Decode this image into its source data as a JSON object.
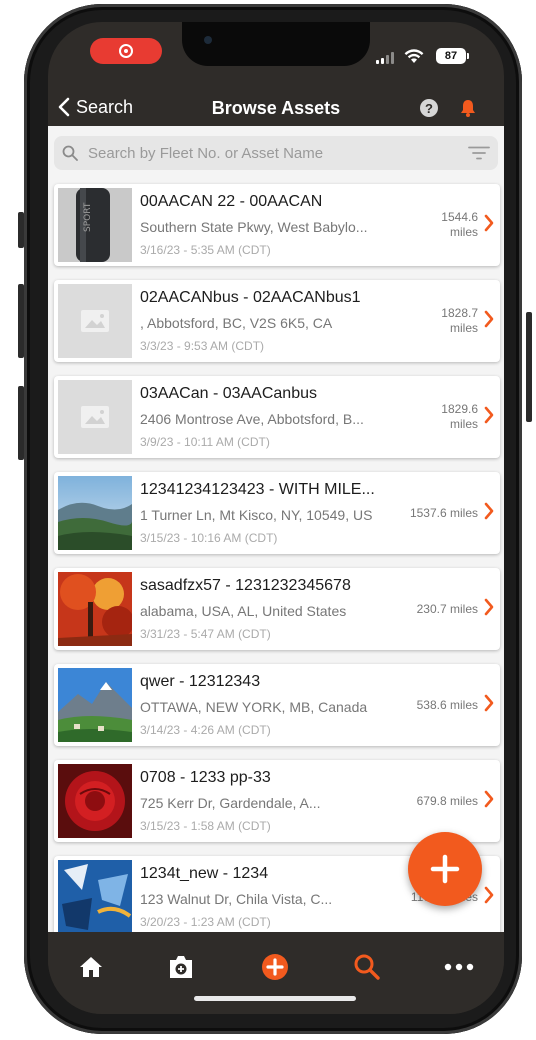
{
  "status_bar": {
    "battery": "87"
  },
  "header": {
    "back_label": "Search",
    "title": "Browse Assets"
  },
  "search": {
    "placeholder": "Search by Fleet No. or Asset Name"
  },
  "assets": [
    {
      "name": "00AACAN 22 - 00AACAN",
      "address": "Southern State Pkwy, West Babylo...",
      "date": "3/16/23 - 5:35 AM (CDT)",
      "miles_value": "1544.6",
      "miles_unit": "miles",
      "image": "black-bottle-photo"
    },
    {
      "name": "02AACANbus - 02AACANbus1",
      "address": ", Abbotsford, BC, V2S 6K5, CA",
      "date": "3/3/23 - 9:53 AM (CDT)",
      "miles_value": "1828.7",
      "miles_unit": "miles",
      "image": "placeholder-image-icon"
    },
    {
      "name": "03AACan - 03AACanbus",
      "address": "2406 Montrose Ave, Abbotsford, B...",
      "date": "3/9/23 - 10:11 AM (CDT)",
      "miles_value": "1829.6",
      "miles_unit": "miles",
      "image": "placeholder-image-icon"
    },
    {
      "name": "12341234123423 - WITH MILE...",
      "address": "1 Turner Ln, Mt Kisco, NY, 10549, US",
      "date": "3/15/23 - 10:16 AM (CDT)",
      "miles": "1537.6 miles",
      "image": "mountain-landscape-photo"
    },
    {
      "name": "sasadfzx57 - 1231232345678",
      "address": "alabama, USA, AL, United States",
      "date": "3/31/23 - 5:47 AM (CDT)",
      "miles": "230.7 miles",
      "image": "autumn-tree-photo"
    },
    {
      "name": "qwer - 12312343",
      "address": "OTTAWA, NEW YORK, MB, Canada",
      "date": "3/14/23 - 4:26 AM (CDT)",
      "miles": "538.6 miles",
      "image": "alpine-village-photo"
    },
    {
      "name": "0708 - 1233 pp-33",
      "address": "725 Kerr Dr, Gardendale, A...",
      "date": "3/15/23 - 1:58 AM (CDT)",
      "miles": "679.8 miles",
      "image": "red-rose-photo"
    },
    {
      "name": "1234t_new - 1234",
      "address": "123 Walnut Dr, Chila Vista, C...",
      "date": "3/20/23 - 1:23 AM (CDT)",
      "miles": "1177.8 miles",
      "image": "blue-graffiti-photo"
    }
  ],
  "tab_bar": {
    "items": [
      "home-icon",
      "camera-icon",
      "add-circle-icon",
      "search-icon",
      "more-icon"
    ],
    "active_color": "#f25a1e"
  },
  "colors": {
    "accent": "#f25a1e",
    "header_bg": "#2f2c29",
    "recording": "#e83b32"
  }
}
